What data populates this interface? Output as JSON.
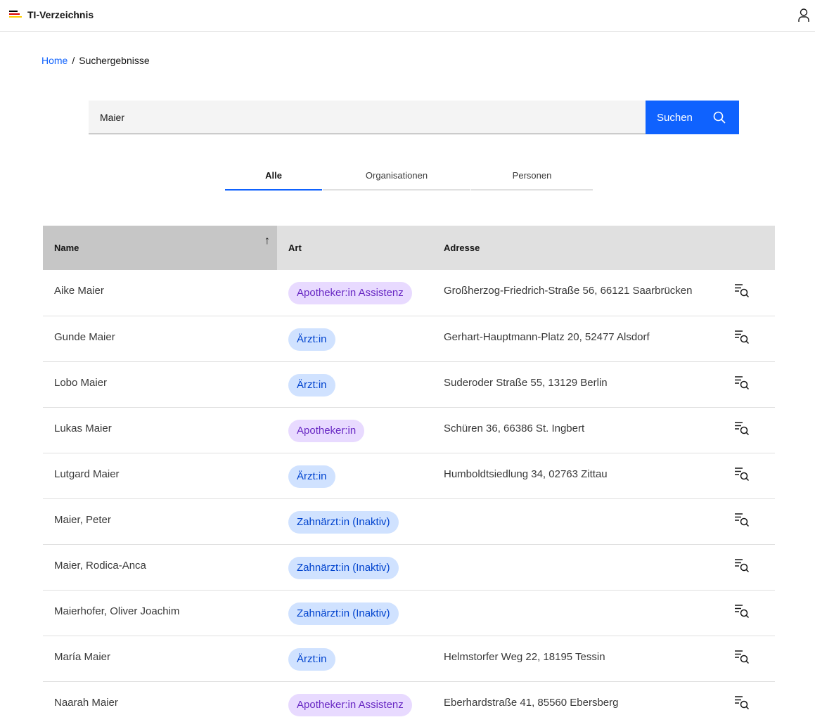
{
  "header": {
    "app_title": "TI-Verzeichnis",
    "flag_colors": [
      "#000000",
      "#dd0000",
      "#ffce00"
    ]
  },
  "breadcrumb": {
    "home": "Home",
    "separator": "/",
    "current": "Suchergebnisse"
  },
  "search": {
    "value": "Maier",
    "button_label": "Suchen",
    "button_color": "#0f62fe"
  },
  "tabs": [
    {
      "label": "Alle",
      "active": true
    },
    {
      "label": "Organisationen",
      "active": false
    },
    {
      "label": "Personen",
      "active": false
    }
  ],
  "table": {
    "columns": [
      "Name",
      "Art",
      "Adresse"
    ],
    "sort": {
      "column": "Name",
      "direction": "ascending"
    },
    "rows": [
      {
        "name": "Aike Maier",
        "art": "Apotheker:in Assistenz",
        "adresse": "Großherzog-Friedrich-Straße 56, 66121 Saarbrücken"
      },
      {
        "name": "Gunde Maier",
        "art": "Ärzt:in",
        "adresse": "Gerhart-Hauptmann-Platz 20, 52477 Alsdorf"
      },
      {
        "name": "Lobo Maier",
        "art": "Ärzt:in",
        "adresse": "Suderoder Straße 55, 13129 Berlin"
      },
      {
        "name": "Lukas Maier",
        "art": "Apotheker:in",
        "adresse": "Schüren 36, 66386 St. Ingbert"
      },
      {
        "name": "Lutgard Maier",
        "art": "Ärzt:in",
        "adresse": "Humboldtsiedlung 34, 02763 Zittau"
      },
      {
        "name": "Maier, Peter",
        "art": "Zahnärzt:in (Inaktiv)",
        "adresse": ""
      },
      {
        "name": "Maier, Rodica-Anca",
        "art": "Zahnärzt:in (Inaktiv)",
        "adresse": ""
      },
      {
        "name": "Maierhofer, Oliver Joachim",
        "art": "Zahnärzt:in (Inaktiv)",
        "adresse": ""
      },
      {
        "name": "María Maier",
        "art": "Ärzt:in",
        "adresse": "Helmstorfer Weg 22, 18195 Tessin"
      },
      {
        "name": "Naarah Maier",
        "art": "Apotheker:in Assistenz",
        "adresse": "Eberhardstraße 41, 85560 Ebersberg"
      }
    ]
  }
}
